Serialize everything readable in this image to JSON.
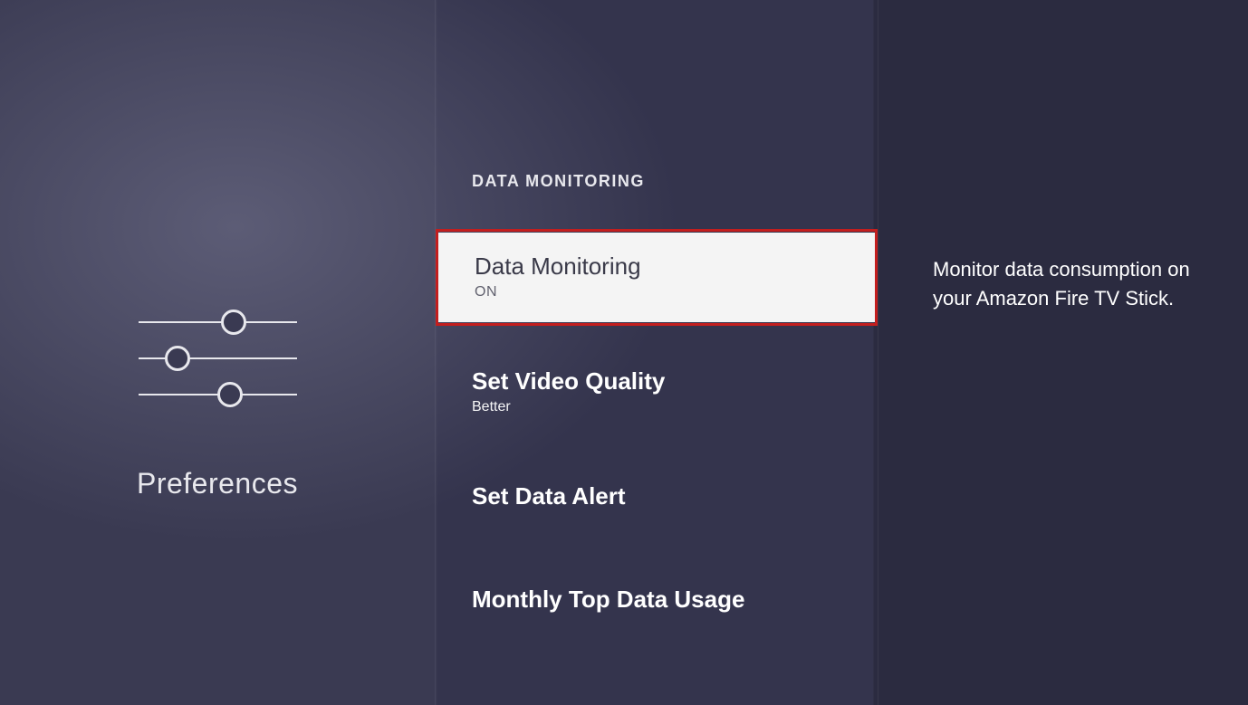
{
  "left": {
    "title": "Preferences"
  },
  "header": {
    "title": "DATA MONITORING"
  },
  "menu": {
    "items": [
      {
        "label": "Data Monitoring",
        "value": "ON",
        "selected": true
      },
      {
        "label": "Set Video Quality",
        "value": "Better"
      },
      {
        "label": "Set Data Alert"
      },
      {
        "label": "Monthly Top Data Usage"
      }
    ]
  },
  "description": "Monitor data consumption on your Amazon Fire TV Stick.",
  "highlight_color": "#d11a1a"
}
